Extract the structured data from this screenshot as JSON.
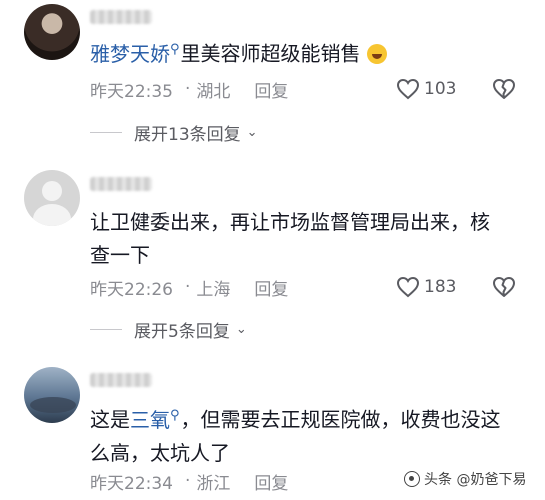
{
  "comments": [
    {
      "mention": "雅梦天娇",
      "text": "里美容师超级能销售",
      "time": "昨天22:35",
      "location": "湖北",
      "reply": "回复",
      "likes": "103",
      "expand": "展开13条回复"
    },
    {
      "text": "让卫健委出来，再让市场监督管理局出来，核查一下",
      "time": "昨天22:26",
      "location": "上海",
      "reply": "回复",
      "likes": "183",
      "expand": "展开5条回复"
    },
    {
      "text_before": "这是",
      "mention": "三氧",
      "text_after": "，但需要去正规医院做，收费也没这么高，太坑人了",
      "time": "昨天22:34",
      "location": "浙江",
      "reply": "回复"
    }
  ],
  "separator": "·",
  "watermark": "头条 @奶爸下易"
}
